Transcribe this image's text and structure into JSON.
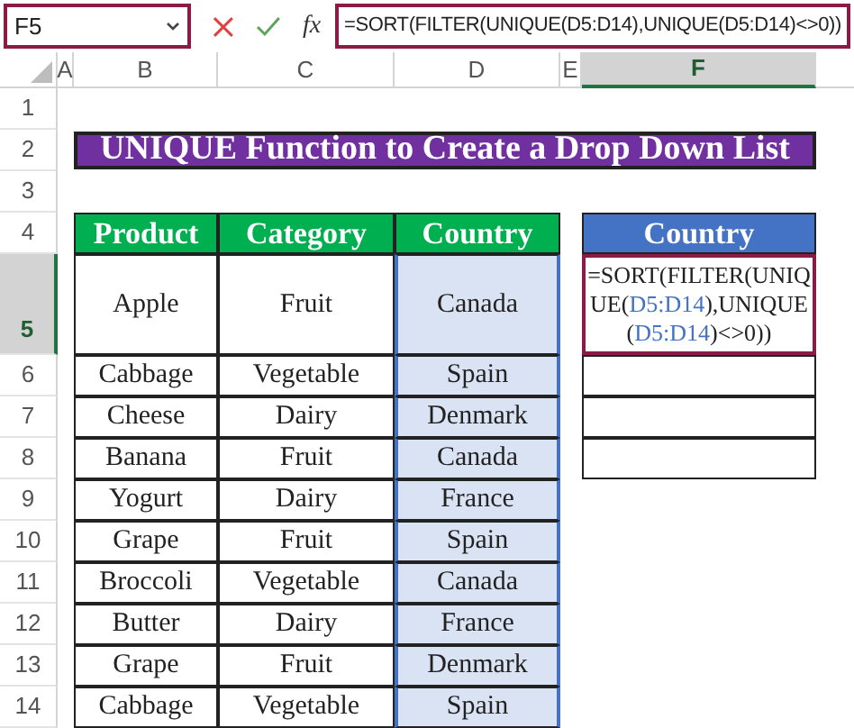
{
  "formula_bar": {
    "name_box": "F5",
    "function_label": "fx",
    "formula": "=SORT(FILTER(UNIQUE(D5:D14),UNIQUE(D5:D14)<>0))"
  },
  "columns": [
    {
      "label": "A",
      "selected": false
    },
    {
      "label": "B",
      "selected": false
    },
    {
      "label": "C",
      "selected": false
    },
    {
      "label": "D",
      "selected": false
    },
    {
      "label": "E",
      "selected": false
    },
    {
      "label": "F",
      "selected": true
    }
  ],
  "rows": [
    {
      "label": "1",
      "selected": false
    },
    {
      "label": "2",
      "selected": false
    },
    {
      "label": "3",
      "selected": false
    },
    {
      "label": "4",
      "selected": false
    },
    {
      "label": "5",
      "selected": true
    },
    {
      "label": "6",
      "selected": false
    },
    {
      "label": "7",
      "selected": false
    },
    {
      "label": "8",
      "selected": false
    },
    {
      "label": "9",
      "selected": false
    },
    {
      "label": "10",
      "selected": false
    },
    {
      "label": "11",
      "selected": false
    },
    {
      "label": "12",
      "selected": false
    },
    {
      "label": "13",
      "selected": false
    },
    {
      "label": "14",
      "selected": false
    }
  ],
  "title": "UNIQUE Function to Create a Drop Down List",
  "table": {
    "columns": [
      {
        "label": "Product",
        "selected": false
      },
      {
        "label": "Category",
        "selected": false
      },
      {
        "label": "Country",
        "selected": true
      }
    ],
    "rows": [
      [
        "Apple",
        "Fruit",
        "Canada"
      ],
      [
        "Cabbage",
        "Vegetable",
        "Spain"
      ],
      [
        "Cheese",
        "Dairy",
        "Denmark"
      ],
      [
        "Banana",
        "Fruit",
        "Canada"
      ],
      [
        "Yogurt",
        "Dairy",
        "France"
      ],
      [
        "Grape",
        "Fruit",
        "Spain"
      ],
      [
        "Broccoli",
        "Vegetable",
        "Canada"
      ],
      [
        "Butter",
        "Dairy",
        "France"
      ],
      [
        "Grape",
        "Fruit",
        "Denmark"
      ],
      [
        "Cabbage",
        "Vegetable",
        "Spain"
      ]
    ]
  },
  "result": {
    "header": "Country",
    "formula_parts": [
      {
        "kind": "text",
        "text": "=SORT(FILTER(UNIQUE("
      },
      {
        "kind": "ref",
        "text": "D5:D14"
      },
      {
        "kind": "text",
        "text": "),UNIQUE("
      },
      {
        "kind": "ref",
        "text": "D5:D14"
      },
      {
        "kind": "text",
        "text": ")<>0))"
      }
    ]
  }
}
